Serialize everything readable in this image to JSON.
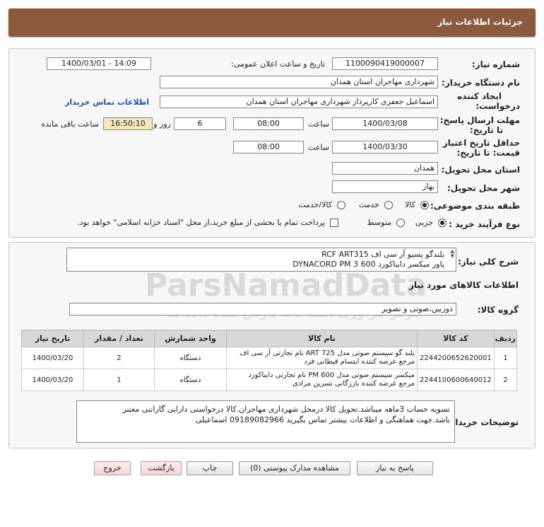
{
  "header": {
    "title": "جزئیات اطلاعات نیاز"
  },
  "form": {
    "need_number_label": "شماره نیاز:",
    "need_number": "1100090419000007",
    "announce_label": "تاریخ و ساعت اعلان عمومی:",
    "announce_value": "1400/03/01 - 14:09",
    "buyer_org_label": "نام دستگاه خریدار:",
    "buyer_org": "شهرداری مهاجران استان همدان",
    "creator_label_line1": "ایجاد کننده",
    "creator_label_line2": "درخواست:",
    "creator": "اسماعیل جعفری کارپرداز شهرداری مهاجران استان همدان",
    "contact_link": "اطلاعات تماس خریدار",
    "deadline_label_line1": "مهلت ارسال پاسخ:",
    "deadline_label_line2": "تا تاریخ:",
    "deadline_date": "1400/03/08",
    "time_label": "ساعت",
    "deadline_time": "08:00",
    "days_value": "6",
    "days_label": "روز و",
    "remaining_time": "16:50:10",
    "remaining_label": "ساعت باقی مانده",
    "validity_label_line1": "حداقل تاریخ اعتبار",
    "validity_label_line2": "قیمت: تا تاریخ:",
    "validity_date": "1400/03/30",
    "validity_time": "08:00",
    "province_label": "استان محل تحویل:",
    "province": "همدان",
    "city_label": "شهر محل تحویل:",
    "city": "بهار",
    "category_label": "طبقه بندی موضوعی:",
    "category_options": [
      "کالا",
      "خدمت",
      "کالا/خدمت"
    ],
    "process_label": "نوع فرآیند خرید :",
    "process_options": [
      "جزیی",
      "متوسط"
    ],
    "payment_note": "پرداخت تمام یا بخشی از مبلغ خرید،از محل \"اسناد خزانه اسلامی\" خواهد بود."
  },
  "summary": {
    "label": "شرح کلی نیاز:",
    "line1": "بلندگو پسیو آر سی اف RCF ART315",
    "line2": "پاور میکسر دایناکورد DYNACORD PM 3 600"
  },
  "goods": {
    "section_title": "اطلاعات کالاهای مورد نیاز",
    "group_label": "گروه کالا:",
    "group_value": "دوربین،صوتی و تصویر",
    "columns": [
      "ردیف",
      "کد کالا",
      "نام کالا",
      "واحد شمارش",
      "تعداد / مقدار",
      "تاریخ نیاز"
    ],
    "rows": [
      {
        "index": "1",
        "code": "2244200652620001",
        "name_line1": "بلند گو سیستم صوتی مدل ART 725 نام تجارتی آر سی اف",
        "name_line2": "مرجع عرضه کننده ابتسام قیطانی فرد",
        "unit": "دستگاه",
        "qty": "2",
        "date": "1400/03/20"
      },
      {
        "index": "2",
        "code": "2244100600640012",
        "name_line1": "میکسر سیستم صوتی مدل PM 600 نام تجارتی دایناکورد",
        "name_line2": "مرجع عرضه کننده بازرگانی نسرین مرادی",
        "unit": "دستگاه",
        "qty": "1",
        "date": "1400/03/20"
      }
    ]
  },
  "buyer_notes": {
    "label": "توضیحات خریدار:",
    "line1": "تسویه حساب 3ماهه میباشد.تحویل کالا درمحل شهرداری مهاجران.کالا درخواستی دارایی گارانتی معتبر",
    "line2": "باشد.جهت هماهنگی و اطلاعات بیشتر تماس بگیرید 09189082966 اسماعیلی"
  },
  "buttons": {
    "reply": "پاسخ به نیاز",
    "view_docs": "مشاهده مدارک پیوستی (0)",
    "print": "چاپ",
    "back": "بازگشت",
    "exit": "خروج"
  },
  "watermark": {
    "brand": "ParsNamadData",
    "tagline": "مرکز فراوری اطلاعات پارس نماد داده ها",
    "tagline2": "پایگاه اطلاع رسانی مناقصه و مزایده",
    "phone": "۰۲۱-۸۸۳۴۹۶۷۰"
  }
}
